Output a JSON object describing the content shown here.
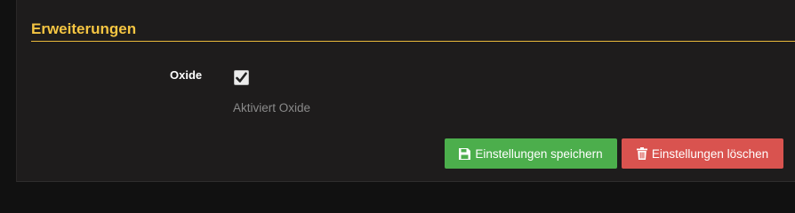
{
  "section": {
    "title": "Erweiterungen"
  },
  "field": {
    "label": "Oxide",
    "checked": true,
    "help": "Aktiviert Oxide"
  },
  "buttons": {
    "save_label": "Einstellungen speichern",
    "save_icon": "floppy-disk-icon",
    "save_color": "#4cae4c",
    "delete_label": "Einstellungen löschen",
    "delete_icon": "trash-icon",
    "delete_color": "#d9534f"
  },
  "colors": {
    "accent": "#f5c542",
    "background": "#1e1c1c"
  }
}
